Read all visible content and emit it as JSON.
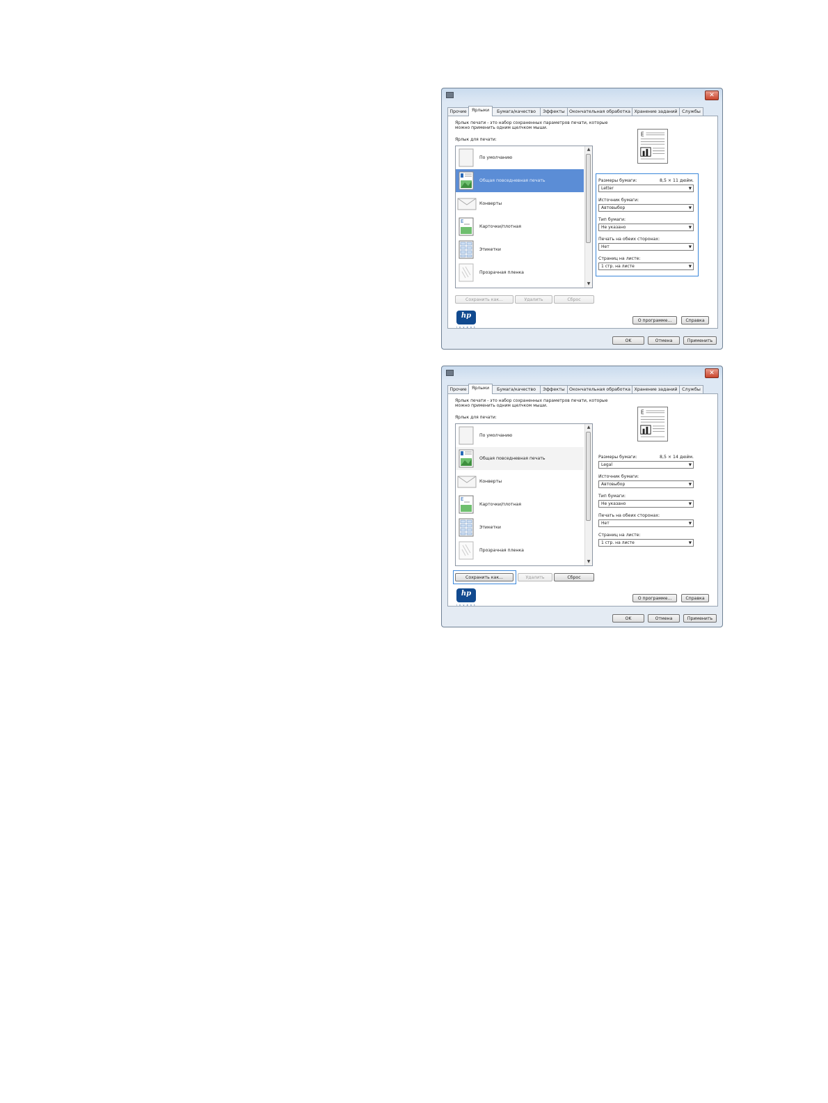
{
  "tabs": [
    "Прочие",
    "Ярлыки",
    "Бумага/качество",
    "Эффекты",
    "Окончательная обработка",
    "Хранение заданий",
    "Службы"
  ],
  "dialogs": [
    {
      "intro_line1": "Ярлык печати - это набор сохраненных параметров печати, которые",
      "intro_line2": "можно применить одним щелчком мыши.",
      "list_label": "Ярлык для печати:",
      "shortcuts": [
        "По умолчанию",
        "Общая повседневная печать",
        "Конверты",
        "Карточки/плотная",
        "Этикетки",
        "Прозрачная пленка"
      ],
      "selected_index": 1,
      "paper_size_label": "Размеры бумаги:",
      "paper_size_dims": "8,5 × 11 дюйм.",
      "paper_size_value": "Letter",
      "paper_source_label": "Источник бумаги:",
      "paper_source_value": "Автовыбор",
      "paper_type_label": "Тип бумаги:",
      "paper_type_value": "Не указано",
      "duplex_label": "Печать на обеих сторонах:",
      "duplex_value": "Нет",
      "pages_label": "Страниц на листе:",
      "pages_value": "1 стр. на листе",
      "save_as": "Сохранить как...",
      "delete": "Удалить",
      "reset": "Сброс",
      "about": "О программе...",
      "help": "Справка",
      "ok": "OK",
      "cancel": "Отмена",
      "apply": "Применить"
    },
    {
      "intro_line1": "Ярлык печати - это набор сохраненных параметров печати, которые",
      "intro_line2": "можно применить одним щелчком мыши.",
      "list_label": "Ярлык для печати:",
      "shortcuts": [
        "По умолчанию",
        "Общая повседневная печать",
        "Конверты",
        "Карточки/плотная",
        "Этикетки",
        "Прозрачная пленка"
      ],
      "selected_index": 1,
      "paper_size_label": "Размеры бумаги:",
      "paper_size_dims": "8,5 × 14 дюйм.",
      "paper_size_value": "Legal",
      "paper_source_label": "Источник бумаги:",
      "paper_source_value": "Автовыбор",
      "paper_type_label": "Тип бумаги:",
      "paper_type_value": "Не указано",
      "duplex_label": "Печать на обеих сторонах:",
      "duplex_value": "Нет",
      "pages_label": "Страниц на листе:",
      "pages_value": "1 стр. на листе",
      "save_as": "Сохранить как...",
      "delete": "Удалить",
      "reset": "Сброс",
      "about": "О программе...",
      "help": "Справка",
      "ok": "OK",
      "cancel": "Отмена",
      "apply": "Применить"
    }
  ],
  "brand": {
    "logo": "hp",
    "logo_tagline": "i n v e n t"
  },
  "colors": {
    "selection": "#5b8dd6",
    "highlight_frame": "#3b87d9",
    "close_button": "#c9452d"
  },
  "icons": [
    "app-icon",
    "close-icon",
    "blank-page-icon",
    "document-image-icon",
    "envelope-icon",
    "card-icon",
    "labels-icon",
    "transparency-icon",
    "page-preview-icon",
    "hp-logo-icon"
  ]
}
